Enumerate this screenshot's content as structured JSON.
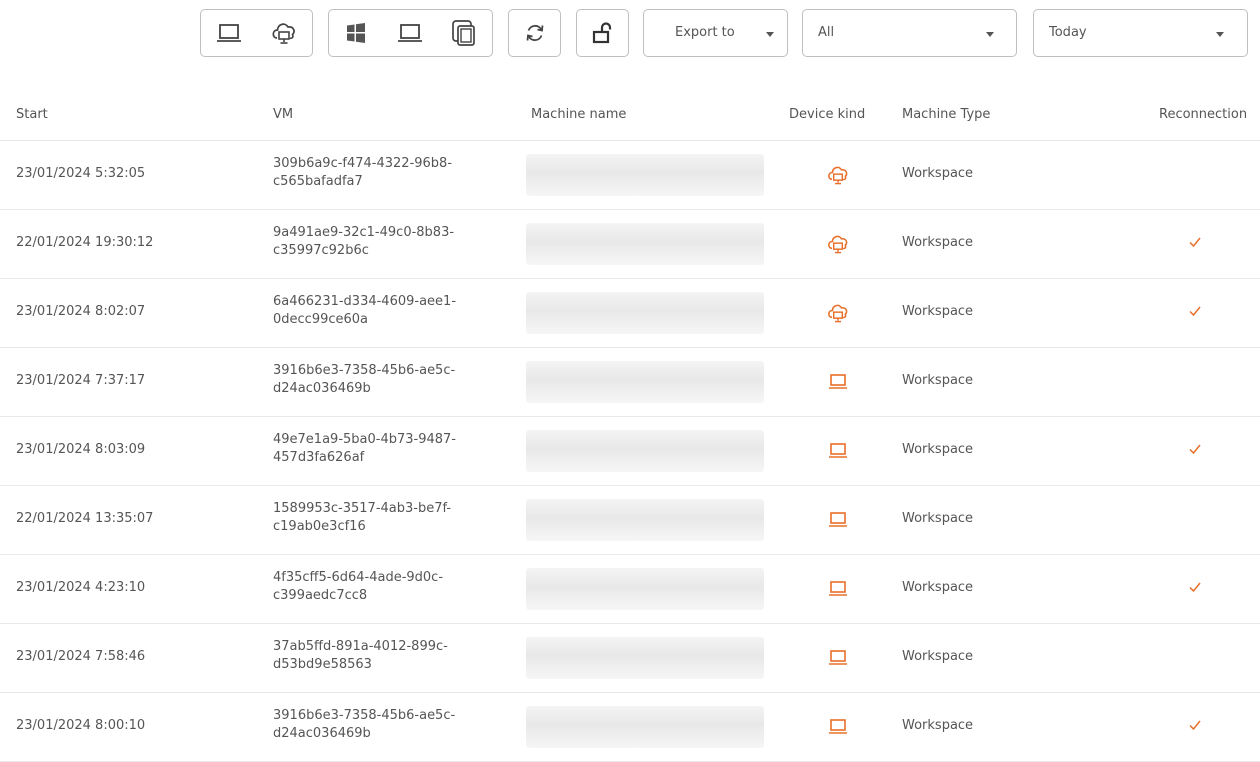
{
  "toolbar": {
    "device_filter": [
      "laptop-icon",
      "cloud-pc-icon"
    ],
    "os_filter": [
      "windows-icon",
      "laptop-icon",
      "copy-icon"
    ],
    "refresh_icon": "refresh-icon",
    "unlock_icon": "unlock-icon",
    "export": {
      "label": "Export to"
    },
    "scope": {
      "value": "All"
    },
    "period": {
      "value": "Today"
    }
  },
  "table": {
    "columns": {
      "start": "Start",
      "vm": "VM",
      "machine_name": "Machine name",
      "device_kind": "Device kind",
      "machine_type": "Machine Type",
      "reconnection": "Reconnection"
    },
    "rows": [
      {
        "start": "23/01/2024 5:32:05",
        "vm_line1": "309b6a9c-f474-4322-96b8-",
        "vm_line2": "c565bafadfa7",
        "machine_name": "",
        "device": "cloud-pc-icon",
        "type": "Workspace",
        "reconnection": false
      },
      {
        "start": "22/01/2024 19:30:12",
        "vm_line1": "9a491ae9-32c1-49c0-8b83-",
        "vm_line2": "c35997c92b6c",
        "machine_name": "",
        "device": "cloud-pc-icon",
        "type": "Workspace",
        "reconnection": true
      },
      {
        "start": "23/01/2024 8:02:07",
        "vm_line1": "6a466231-d334-4609-aee1-",
        "vm_line2": "0decc99ce60a",
        "machine_name": "",
        "device": "cloud-pc-icon",
        "type": "Workspace",
        "reconnection": true
      },
      {
        "start": "23/01/2024 7:37:17",
        "vm_line1": "3916b6e3-7358-45b6-ae5c-",
        "vm_line2": "d24ac036469b",
        "machine_name": "",
        "device": "laptop-icon",
        "type": "Workspace",
        "reconnection": false
      },
      {
        "start": "23/01/2024 8:03:09",
        "vm_line1": "49e7e1a9-5ba0-4b73-9487-",
        "vm_line2": "457d3fa626af",
        "machine_name": "",
        "device": "laptop-icon",
        "type": "Workspace",
        "reconnection": true
      },
      {
        "start": "22/01/2024 13:35:07",
        "vm_line1": "1589953c-3517-4ab3-be7f-",
        "vm_line2": "c19ab0e3cf16",
        "machine_name": "",
        "device": "laptop-icon",
        "type": "Workspace",
        "reconnection": false
      },
      {
        "start": "23/01/2024 4:23:10",
        "vm_line1": "4f35cff5-6d64-4ade-9d0c-",
        "vm_line2": "c399aedc7cc8",
        "machine_name": "",
        "device": "laptop-icon",
        "type": "Workspace",
        "reconnection": true
      },
      {
        "start": "23/01/2024 7:58:46",
        "vm_line1": "37ab5ffd-891a-4012-899c-",
        "vm_line2": "d53bd9e58563",
        "machine_name": "",
        "device": "laptop-icon",
        "type": "Workspace",
        "reconnection": false
      },
      {
        "start": "23/01/2024 8:00:10",
        "vm_line1": "3916b6e3-7358-45b6-ae5c-",
        "vm_line2": "d24ac036469b",
        "machine_name": "",
        "device": "laptop-icon",
        "type": "Workspace",
        "reconnection": true
      }
    ]
  },
  "colors": {
    "accent": "#e8702a",
    "icon_gray": "#444444",
    "border": "#bfbfbf",
    "divider": "#e9e9e9"
  }
}
